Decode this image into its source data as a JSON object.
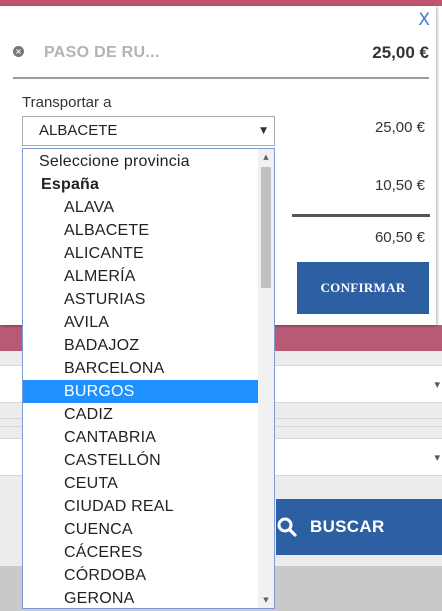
{
  "modal": {
    "close_label": "X",
    "item": {
      "name": "PASO DE RU...",
      "price": "25,00 €"
    },
    "transport_label": "Transportar a",
    "selected_province": "ALBACETE",
    "prices": [
      "25,00 €",
      "10,50 €",
      "60,50 €"
    ],
    "confirm_label": "CONFIRMAR"
  },
  "dropdown": {
    "placeholder": "Seleccione provincia",
    "group": "España",
    "options": [
      "ALAVA",
      "ALBACETE",
      "ALICANTE",
      "ALMERÍA",
      "ASTURIAS",
      "AVILA",
      "BADAJOZ",
      "BARCELONA",
      "BURGOS",
      "CADIZ",
      "CANTABRIA",
      "CASTELLÓN",
      "CEUTA",
      "CIUDAD REAL",
      "CUENCA",
      "CÁCERES",
      "CÓRDOBA",
      "GERONA"
    ],
    "highlighted": "BURGOS"
  },
  "background": {
    "search_label": "BUSCAR"
  },
  "colors": {
    "accent_blue": "#2d5fa3",
    "highlight_blue": "#1e90ff",
    "pink_band": "#b85a76"
  }
}
